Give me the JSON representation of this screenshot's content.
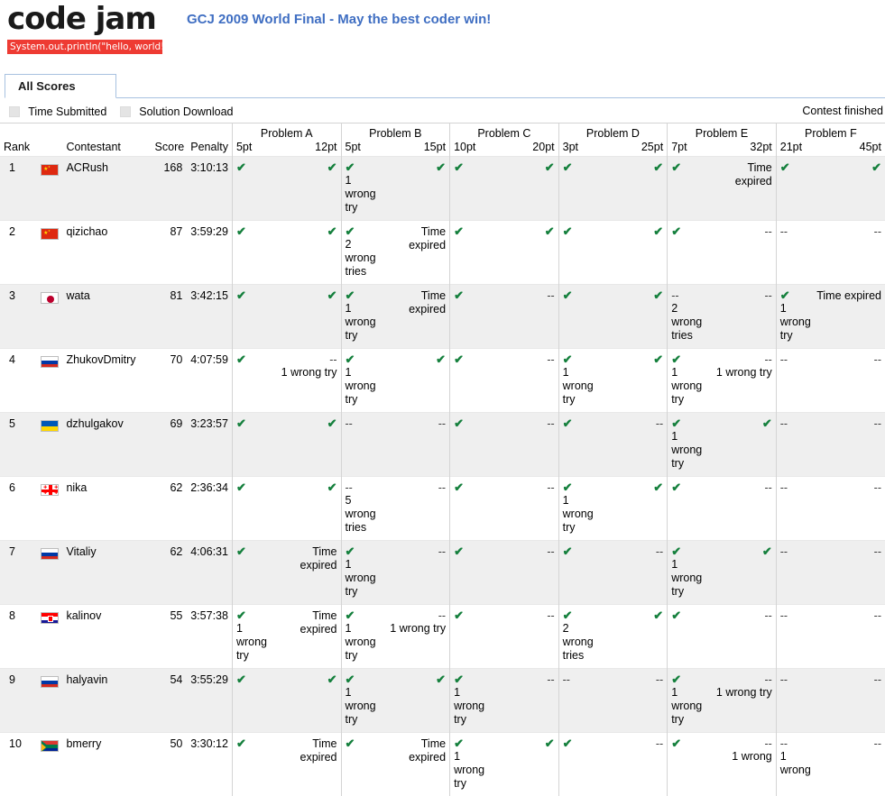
{
  "brand": {
    "logo_text": "code jam",
    "logo_code": "System.out.println(\"hello, world!\");",
    "logo_bg": "#ee3b33"
  },
  "header": {
    "contest_title": "GCJ 2009 World Final - May the best coder win!",
    "title_color": "#3f6ec2"
  },
  "tabs": [
    {
      "label": "All Scores",
      "active": true
    }
  ],
  "options": [
    {
      "label": "Time Submitted",
      "checked": false
    },
    {
      "label": "Solution Download",
      "checked": false
    }
  ],
  "status": {
    "text": "Contest finished"
  },
  "table": {
    "fixed_headers": {
      "rank": "Rank",
      "contestant": "Contestant",
      "score": "Score",
      "penalty": "Penalty"
    },
    "problems": [
      {
        "name": "Problem A",
        "small": "5pt",
        "large": "12pt"
      },
      {
        "name": "Problem B",
        "small": "5pt",
        "large": "15pt"
      },
      {
        "name": "Problem C",
        "small": "10pt",
        "large": "20pt"
      },
      {
        "name": "Problem D",
        "small": "3pt",
        "large": "25pt"
      },
      {
        "name": "Problem E",
        "small": "7pt",
        "large": "32pt"
      },
      {
        "name": "Problem F",
        "small": "21pt",
        "large": "45pt"
      }
    ],
    "glyphs": {
      "solved": "✔",
      "none": "--",
      "expired": "Time expired"
    },
    "colors": {
      "solved": "#15803d",
      "row_odd": "#efefef",
      "row_even": "#ffffff"
    },
    "rows": [
      {
        "rank": "1",
        "flag": "cn",
        "flag_title": "China",
        "contestant": "ACRush",
        "score": "168",
        "penalty": "3:10:13",
        "cells": [
          {
            "state": "solved",
            "note": ""
          },
          {
            "state": "solved",
            "note": ""
          },
          {
            "state": "solved",
            "note": "1 wrong try"
          },
          {
            "state": "solved",
            "note": ""
          },
          {
            "state": "solved",
            "note": ""
          },
          {
            "state": "solved",
            "note": ""
          },
          {
            "state": "solved",
            "note": ""
          },
          {
            "state": "solved",
            "note": ""
          },
          {
            "state": "solved",
            "note": ""
          },
          {
            "state": "expired",
            "note": ""
          },
          {
            "state": "solved",
            "note": ""
          },
          {
            "state": "solved",
            "note": ""
          }
        ]
      },
      {
        "rank": "2",
        "flag": "cn",
        "flag_title": "China",
        "contestant": "qizichao",
        "score": "87",
        "penalty": "3:59:29",
        "cells": [
          {
            "state": "solved",
            "note": ""
          },
          {
            "state": "solved",
            "note": ""
          },
          {
            "state": "solved",
            "note": "2 wrong tries"
          },
          {
            "state": "expired",
            "note": ""
          },
          {
            "state": "solved",
            "note": ""
          },
          {
            "state": "solved",
            "note": ""
          },
          {
            "state": "solved",
            "note": ""
          },
          {
            "state": "solved",
            "note": ""
          },
          {
            "state": "solved",
            "note": ""
          },
          {
            "state": "none",
            "note": ""
          },
          {
            "state": "none",
            "note": ""
          },
          {
            "state": "none",
            "note": ""
          }
        ]
      },
      {
        "rank": "3",
        "flag": "jp",
        "flag_title": "Japan",
        "contestant": "wata",
        "score": "81",
        "penalty": "3:42:15",
        "cells": [
          {
            "state": "solved",
            "note": ""
          },
          {
            "state": "solved",
            "note": ""
          },
          {
            "state": "solved",
            "note": "1 wrong try"
          },
          {
            "state": "expired",
            "note": ""
          },
          {
            "state": "solved",
            "note": ""
          },
          {
            "state": "none",
            "note": ""
          },
          {
            "state": "solved",
            "note": ""
          },
          {
            "state": "solved",
            "note": ""
          },
          {
            "state": "none",
            "note": "2 wrong tries"
          },
          {
            "state": "none",
            "note": ""
          },
          {
            "state": "solved",
            "note": "1 wrong try"
          },
          {
            "state": "expired",
            "note": ""
          }
        ]
      },
      {
        "rank": "4",
        "flag": "ru",
        "flag_title": "Russia",
        "contestant": "ZhukovDmitry",
        "score": "70",
        "penalty": "4:07:59",
        "cells": [
          {
            "state": "solved",
            "note": ""
          },
          {
            "state": "none",
            "note": "1 wrong try"
          },
          {
            "state": "solved",
            "note": "1 wrong try"
          },
          {
            "state": "solved",
            "note": ""
          },
          {
            "state": "solved",
            "note": ""
          },
          {
            "state": "none",
            "note": ""
          },
          {
            "state": "solved",
            "note": "1 wrong try"
          },
          {
            "state": "solved",
            "note": ""
          },
          {
            "state": "solved",
            "note": "1 wrong try"
          },
          {
            "state": "none",
            "note": "1 wrong try"
          },
          {
            "state": "none",
            "note": ""
          },
          {
            "state": "none",
            "note": ""
          }
        ]
      },
      {
        "rank": "5",
        "flag": "ua",
        "flag_title": "Ukraine",
        "contestant": "dzhulgakov",
        "score": "69",
        "penalty": "3:23:57",
        "cells": [
          {
            "state": "solved",
            "note": ""
          },
          {
            "state": "solved",
            "note": ""
          },
          {
            "state": "none",
            "note": ""
          },
          {
            "state": "none",
            "note": ""
          },
          {
            "state": "solved",
            "note": ""
          },
          {
            "state": "none",
            "note": ""
          },
          {
            "state": "solved",
            "note": ""
          },
          {
            "state": "none",
            "note": ""
          },
          {
            "state": "solved",
            "note": "1 wrong try"
          },
          {
            "state": "solved",
            "note": ""
          },
          {
            "state": "none",
            "note": ""
          },
          {
            "state": "none",
            "note": ""
          }
        ]
      },
      {
        "rank": "6",
        "flag": "ge",
        "flag_title": "Georgia",
        "contestant": "nika",
        "score": "62",
        "penalty": "2:36:34",
        "cells": [
          {
            "state": "solved",
            "note": ""
          },
          {
            "state": "solved",
            "note": ""
          },
          {
            "state": "none",
            "note": "5 wrong tries"
          },
          {
            "state": "none",
            "note": ""
          },
          {
            "state": "solved",
            "note": ""
          },
          {
            "state": "none",
            "note": ""
          },
          {
            "state": "solved",
            "note": "1 wrong try"
          },
          {
            "state": "solved",
            "note": ""
          },
          {
            "state": "solved",
            "note": ""
          },
          {
            "state": "none",
            "note": ""
          },
          {
            "state": "none",
            "note": ""
          },
          {
            "state": "none",
            "note": ""
          }
        ]
      },
      {
        "rank": "7",
        "flag": "ru",
        "flag_title": "Russia",
        "contestant": "Vitaliy",
        "score": "62",
        "penalty": "4:06:31",
        "cells": [
          {
            "state": "solved",
            "note": ""
          },
          {
            "state": "expired",
            "note": ""
          },
          {
            "state": "solved",
            "note": "1 wrong try"
          },
          {
            "state": "none",
            "note": ""
          },
          {
            "state": "solved",
            "note": ""
          },
          {
            "state": "none",
            "note": ""
          },
          {
            "state": "solved",
            "note": ""
          },
          {
            "state": "none",
            "note": ""
          },
          {
            "state": "solved",
            "note": "1 wrong try"
          },
          {
            "state": "solved",
            "note": ""
          },
          {
            "state": "none",
            "note": ""
          },
          {
            "state": "none",
            "note": ""
          }
        ]
      },
      {
        "rank": "8",
        "flag": "hr",
        "flag_title": "Croatia",
        "contestant": "kalinov",
        "score": "55",
        "penalty": "3:57:38",
        "cells": [
          {
            "state": "solved",
            "note": "1 wrong try"
          },
          {
            "state": "expired",
            "note": ""
          },
          {
            "state": "solved",
            "note": "1 wrong try"
          },
          {
            "state": "none",
            "note": "1 wrong try"
          },
          {
            "state": "solved",
            "note": ""
          },
          {
            "state": "none",
            "note": ""
          },
          {
            "state": "solved",
            "note": "2 wrong tries"
          },
          {
            "state": "solved",
            "note": ""
          },
          {
            "state": "solved",
            "note": ""
          },
          {
            "state": "none",
            "note": ""
          },
          {
            "state": "none",
            "note": ""
          },
          {
            "state": "none",
            "note": ""
          }
        ]
      },
      {
        "rank": "9",
        "flag": "ru",
        "flag_title": "Russia",
        "contestant": "halyavin",
        "score": "54",
        "penalty": "3:55:29",
        "cells": [
          {
            "state": "solved",
            "note": ""
          },
          {
            "state": "solved",
            "note": ""
          },
          {
            "state": "solved",
            "note": "1 wrong try"
          },
          {
            "state": "solved",
            "note": ""
          },
          {
            "state": "solved",
            "note": "1 wrong try"
          },
          {
            "state": "none",
            "note": ""
          },
          {
            "state": "none",
            "note": ""
          },
          {
            "state": "none",
            "note": ""
          },
          {
            "state": "solved",
            "note": "1 wrong try"
          },
          {
            "state": "none",
            "note": "1 wrong try"
          },
          {
            "state": "none",
            "note": ""
          },
          {
            "state": "none",
            "note": ""
          }
        ]
      },
      {
        "rank": "10",
        "flag": "za",
        "flag_title": "South Africa",
        "contestant": "bmerry",
        "score": "50",
        "penalty": "3:30:12",
        "cells": [
          {
            "state": "solved",
            "note": ""
          },
          {
            "state": "expired",
            "note": ""
          },
          {
            "state": "solved",
            "note": ""
          },
          {
            "state": "expired",
            "note": ""
          },
          {
            "state": "solved",
            "note": "1 wrong try"
          },
          {
            "state": "solved",
            "note": ""
          },
          {
            "state": "solved",
            "note": ""
          },
          {
            "state": "none",
            "note": ""
          },
          {
            "state": "solved",
            "note": ""
          },
          {
            "state": "none",
            "note": "1 wrong"
          },
          {
            "state": "none",
            "note": "1 wrong"
          },
          {
            "state": "none",
            "note": ""
          }
        ]
      }
    ]
  }
}
